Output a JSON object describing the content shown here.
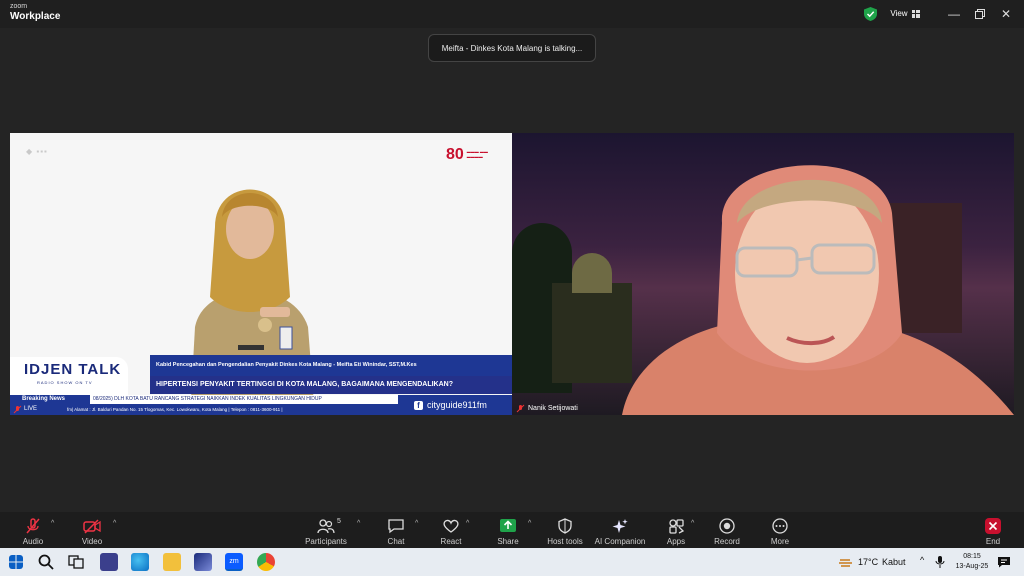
{
  "titlebar": {
    "brand_top": "zoom",
    "brand_bottom": "Workplace",
    "view_label": "View"
  },
  "toast": {
    "text": "Meifta - Dinkes Kota Malang is talking..."
  },
  "tiles": {
    "left": {
      "show_name": "IDJEN TALK",
      "show_sub": "RADIO SHOW ON TV",
      "name_line": "Kabid Pencegahan dan Pengendalian Penyakit Dinkes Kota Malang - Meifta Eti Winindar, SST,M.Kes",
      "headline": "HIPERTENSI PENYAKIT TERTINGGI DI KOTA MALANG, BAGAIMANA MENGENDALIKAN?",
      "breaking_label": "Breaking News",
      "ticker_top": "08/2025) DLH KOTA BATU RANCANG STRATEGI NAIKKAN INDEK KUALITAS LINGKUNGAN HIDUP",
      "ticker_bottom": "fm| Alamat : Jl. Balduri Pandan No. 15 Tlogomas, Kec. Lowokwaru, Kota Malang | Telepon : 0811-3600-911 |",
      "live_label": "LIVE",
      "social": "cityguide911fm",
      "anniv_number": "80"
    },
    "right": {
      "participant_name": "Nanik Setijowati"
    }
  },
  "toolbar": {
    "audio": "Audio",
    "video": "Video",
    "participants": "Participants",
    "participants_count": "5",
    "chat": "Chat",
    "react": "React",
    "share": "Share",
    "host_tools": "Host tools",
    "ai_companion": "AI Companion",
    "apps": "Apps",
    "record": "Record",
    "more": "More",
    "end": "End"
  },
  "taskbar": {
    "weather": "17°C",
    "weather_desc": "Kabut",
    "time": "08:15",
    "date": "13-Aug-25"
  },
  "colors": {
    "toolbar_bg": "#1d1d1d",
    "share_green": "#1fa34a",
    "end_red": "#c8102e",
    "broadcast_blue": "#1e3794"
  }
}
